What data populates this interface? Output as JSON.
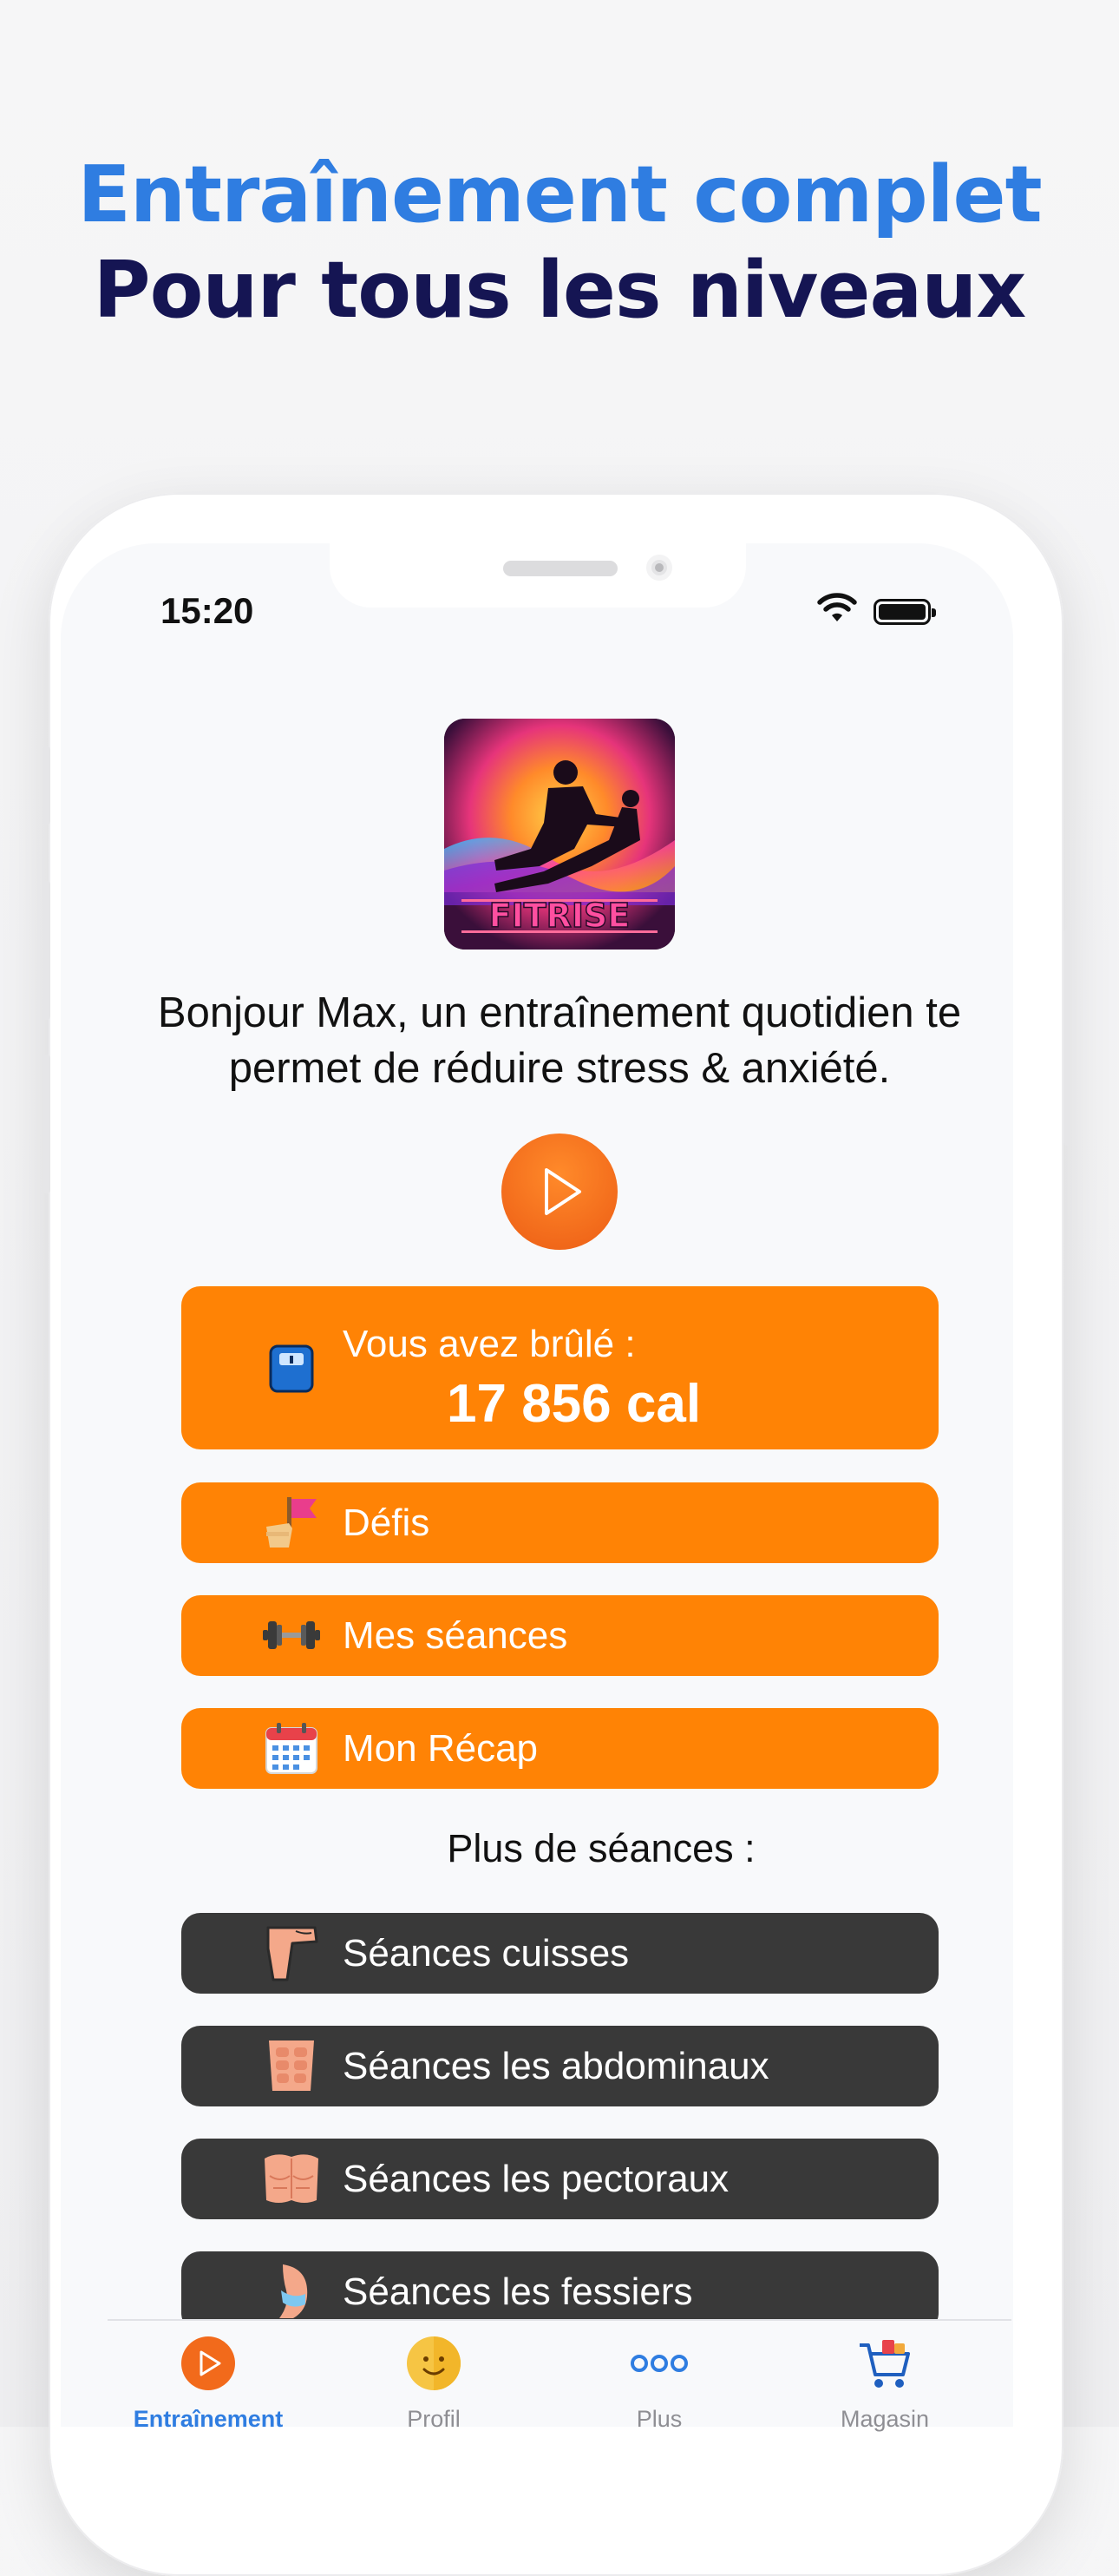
{
  "headline": {
    "line1": "Entraînement complet",
    "line2": "Pour tous les niveaux"
  },
  "status_bar": {
    "time": "15:20",
    "wifi_icon": "wifi-icon",
    "battery_icon": "battery-icon"
  },
  "app": {
    "logo_text": "FITRISE",
    "greeting": "Bonjour Max, un entraînement quotidien te permet de réduire stress & anxiété.",
    "calories": {
      "label": "Vous avez brûlé :",
      "value": "17 856 cal",
      "icon": "scale-icon"
    },
    "menu": [
      {
        "label": "Défis",
        "icon": "flag-icon"
      },
      {
        "label": "Mes séances",
        "icon": "dumbbell-icon"
      },
      {
        "label": "Mon Récap",
        "icon": "calendar-icon"
      }
    ],
    "more_title": "Plus de séances :",
    "sessions": [
      {
        "label": "Séances cuisses",
        "icon": "leg-icon"
      },
      {
        "label": "Séances les abdominaux",
        "icon": "abs-icon"
      },
      {
        "label": "Séances les pectoraux",
        "icon": "chest-icon"
      },
      {
        "label": "Séances les fessiers",
        "icon": "glutes-icon"
      }
    ]
  },
  "tabbar": [
    {
      "label": "Entraînement",
      "icon": "play-icon",
      "active": true
    },
    {
      "label": "Profil",
      "icon": "smiley-icon",
      "active": false
    },
    {
      "label": "Plus",
      "icon": "more-dots-icon",
      "active": false
    },
    {
      "label": "Magasin",
      "icon": "cart-icon",
      "active": false
    }
  ],
  "colors": {
    "headline_blue": "#2f7de1",
    "headline_navy": "#151553",
    "orange_button": "#ff8305",
    "dark_button": "#393939",
    "play_orange": "#f26a1b",
    "tab_active": "#2f7de1",
    "tab_inactive": "#8e8e93"
  }
}
